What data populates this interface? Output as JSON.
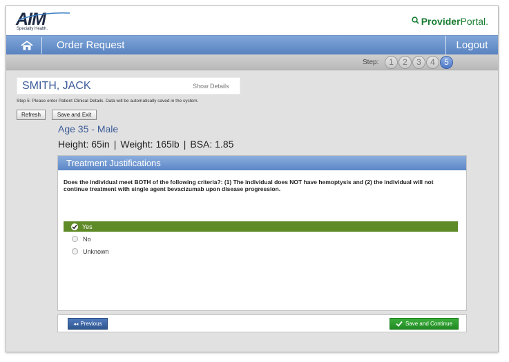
{
  "header": {
    "logo_word": "AIM",
    "logo_sub": "Specialty Health.",
    "portal_part1": "Provider",
    "portal_part2": "Portal",
    "portal_dot": "."
  },
  "nav": {
    "title": "Order Request",
    "logout": "Logout"
  },
  "steps": {
    "label": "Step:",
    "items": [
      "1",
      "2",
      "3",
      "4",
      "5"
    ],
    "active": "5"
  },
  "patient": {
    "name": "SMITH, JACK",
    "show_details": "Show Details",
    "instructions": "Step 5: Please enter Patient Clinical Details. Data will be automatically saved in the system.",
    "refresh_label": "Refresh",
    "save_exit_label": "Save and Exit",
    "age_sex": "Age 35 - Male",
    "height": "Height: 65in",
    "weight": "Weight: 165lb",
    "bsa": "BSA: 1.85",
    "separator": "|"
  },
  "panel": {
    "title": "Treatment Justifications",
    "question": "Does the individual meet BOTH of the following criteria?:  (1) The individual does NOT have hemoptysis and (2) the individual will not continue treatment with single agent bevacizumab upon disease progression.",
    "options": [
      "Yes",
      "No",
      "Unknown"
    ],
    "selected": "Yes"
  },
  "footer": {
    "previous_label": "Previous",
    "continue_label": "Save and Continue"
  },
  "colors": {
    "nav_blue": "#5a84c2",
    "selected_green": "#5f8a28",
    "continue_green": "#1f8a22",
    "name_blue": "#3b5b98"
  }
}
